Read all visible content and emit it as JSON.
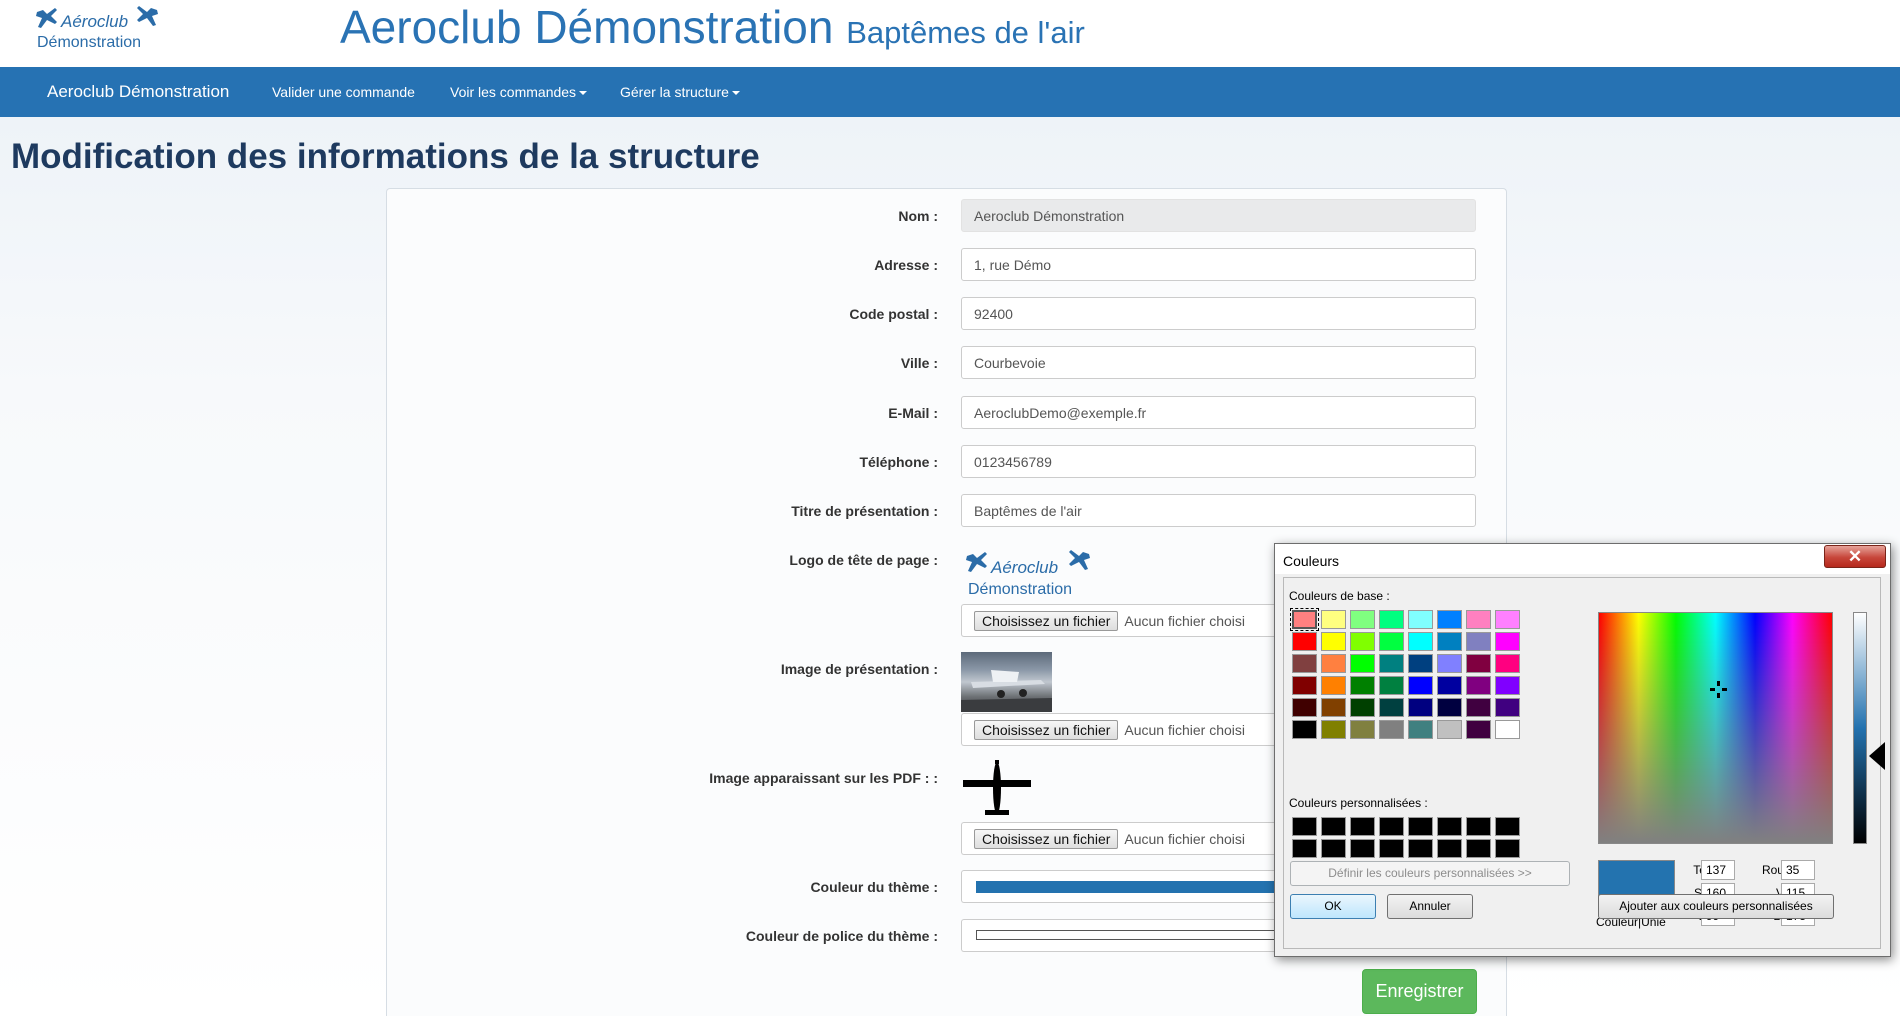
{
  "header": {
    "logo_line1": "Aéroclub",
    "logo_line2": "Démonstration",
    "title": "Aeroclub Démonstration",
    "subtitle": "Baptêmes de l'air"
  },
  "navbar": {
    "brand": "Aeroclub Démonstration",
    "items": [
      {
        "label": "Valider une commande",
        "dropdown": false
      },
      {
        "label": "Voir les commandes",
        "dropdown": true
      },
      {
        "label": "Gérer la structure",
        "dropdown": true
      }
    ]
  },
  "page": {
    "title": "Modification des informations de la structure"
  },
  "form": {
    "nom": {
      "label": "Nom :",
      "value": "Aeroclub Démonstration"
    },
    "adresse": {
      "label": "Adresse :",
      "value": "1, rue Démo"
    },
    "code_postal": {
      "label": "Code postal :",
      "value": "92400"
    },
    "ville": {
      "label": "Ville :",
      "value": "Courbevoie"
    },
    "email": {
      "label": "E-Mail :",
      "value": "AeroclubDemo@exemple.fr"
    },
    "telephone": {
      "label": "Téléphone :",
      "value": "0123456789"
    },
    "titre": {
      "label": "Titre de présentation :",
      "value": "Baptêmes de l'air"
    },
    "logo": {
      "label": "Logo de tête de page :",
      "logo_line1": "Aéroclub",
      "logo_line2": "Démonstration"
    },
    "image_presentation": {
      "label": "Image de présentation :"
    },
    "image_pdf": {
      "label": "Image apparaissant sur les PDF : :"
    },
    "file_button": "Choisissez un fichier",
    "file_status": "Aucun fichier choisi",
    "couleur_theme": {
      "label": "Couleur du thème :",
      "value": "#2372af"
    },
    "couleur_police": {
      "label": "Couleur de police du thème :",
      "value": "#ffffff"
    },
    "save_label": "Enregistrer"
  },
  "color_dialog": {
    "title": "Couleurs",
    "close_label": "✕",
    "basic_colors_label": "Couleurs de base :",
    "custom_colors_label": "Couleurs personnalisées :",
    "define_custom_label": "Définir les couleurs personnalisées >>",
    "ok_label": "OK",
    "cancel_label": "Annuler",
    "add_custom_label": "Ajouter aux couleurs personnalisées",
    "preview_label": "Couleur|Unie",
    "teinte_label": "Teinte :",
    "teinte": "137",
    "satur_label": "Satur. :",
    "satur": "160",
    "lum_label": "Lum. :",
    "lum": "99",
    "rouge_label": "Rouge :",
    "rouge": "35",
    "vert_label": "Vert :",
    "vert": "115",
    "bleu_label": "Bleu :",
    "bleu": "175",
    "basic_colors": [
      [
        "#ff8080",
        "#ffff80",
        "#80ff80",
        "#00ff80",
        "#80ffff",
        "#0080ff",
        "#ff80c0",
        "#ff80ff"
      ],
      [
        "#ff0000",
        "#ffff00",
        "#80ff00",
        "#00ff40",
        "#00ffff",
        "#0080c0",
        "#8080c0",
        "#ff00ff"
      ],
      [
        "#804040",
        "#ff8040",
        "#00ff00",
        "#008080",
        "#004080",
        "#8080ff",
        "#800040",
        "#ff0080"
      ],
      [
        "#800000",
        "#ff8000",
        "#008000",
        "#008040",
        "#0000ff",
        "#0000a0",
        "#800080",
        "#8000ff"
      ],
      [
        "#400000",
        "#804000",
        "#004000",
        "#004040",
        "#000080",
        "#000040",
        "#400040",
        "#400080"
      ],
      [
        "#000000",
        "#808000",
        "#808040",
        "#808080",
        "#408080",
        "#c0c0c0",
        "#400040",
        "#ffffff"
      ]
    ],
    "custom_colors": [
      [
        "#000000",
        "#000000",
        "#000000",
        "#000000",
        "#000000",
        "#000000",
        "#000000",
        "#000000"
      ],
      [
        "#000000",
        "#000000",
        "#000000",
        "#000000",
        "#000000",
        "#000000",
        "#000000",
        "#000000"
      ]
    ]
  }
}
